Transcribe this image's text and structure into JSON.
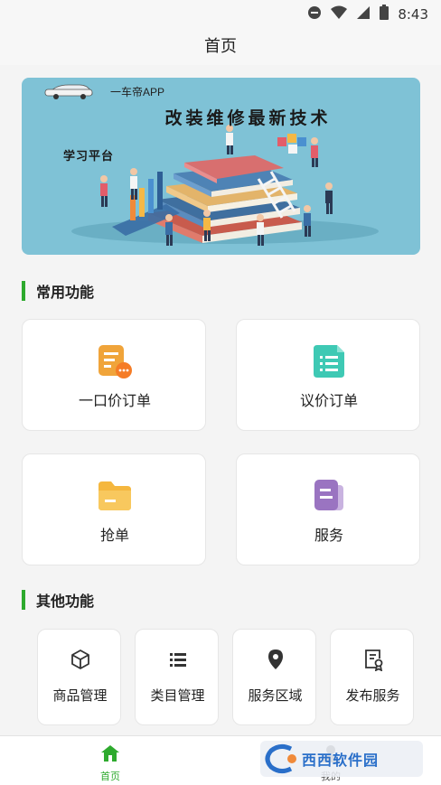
{
  "status_bar": {
    "time": "8:43",
    "icons": [
      "dnd-icon",
      "wifi-icon",
      "cellular-icon",
      "battery-icon"
    ]
  },
  "nav": {
    "title": "首页"
  },
  "banner": {
    "brand": "一车帝APP",
    "headline": "改装维修最新技术",
    "sub": "学习平台"
  },
  "common": {
    "title": "常用功能",
    "items": [
      {
        "label": "一口价订单",
        "icon": "fixed-price-order-icon",
        "color": "#f0a43a"
      },
      {
        "label": "议价订单",
        "icon": "bargain-order-icon",
        "color": "#3ec9b4"
      },
      {
        "label": "抢单",
        "icon": "grab-order-folder-icon",
        "color": "#f5b73e"
      },
      {
        "label": "服务",
        "icon": "service-doc-icon",
        "color": "#9a74c1"
      }
    ]
  },
  "other": {
    "title": "其他功能",
    "items": [
      {
        "label": "商品管理",
        "icon": "box-icon"
      },
      {
        "label": "类目管理",
        "icon": "list-icon"
      },
      {
        "label": "服务区域",
        "icon": "location-pin-icon"
      },
      {
        "label": "发布服务",
        "icon": "certificate-icon"
      }
    ]
  },
  "tabbar": {
    "items": [
      {
        "label": "首页",
        "icon": "home-icon",
        "active": true
      },
      {
        "label": "我的",
        "icon": "profile-icon",
        "active": false
      }
    ],
    "active_color": "#2eaa2e"
  },
  "watermark": {
    "text": "西西软件园"
  },
  "colors": {
    "accent": "#2eaa2e",
    "banner_bg": "#7fc2d6"
  }
}
